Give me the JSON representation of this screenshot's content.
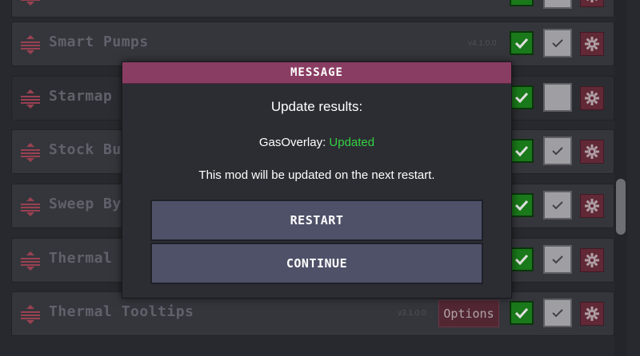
{
  "mods": [
    {
      "name": "",
      "version": "",
      "has_options": false,
      "enabled": true
    },
    {
      "name": "Smart Pumps",
      "version": "v4.1.0.0",
      "has_options": false,
      "enabled": true
    },
    {
      "name": "Starmap Qu",
      "version": "",
      "has_options": false,
      "enabled": true
    },
    {
      "name": "Stock Bug F",
      "version": "",
      "has_options": false,
      "enabled": true
    },
    {
      "name": "Sweep By T",
      "version": "",
      "has_options": false,
      "enabled": true
    },
    {
      "name": "Thermal Int",
      "version": "",
      "has_options": false,
      "enabled": true
    },
    {
      "name": "Thermal Tooltips",
      "version": "v3.1.0.0",
      "has_options": true,
      "options_label": "Options",
      "enabled": true
    }
  ],
  "dialog": {
    "header": "MESSAGE",
    "title": "Update results:",
    "mod_name": "GasOverlay:",
    "mod_status": "Updated",
    "note": "This mod will be updated on the next restart.",
    "restart_label": "RESTART",
    "continue_label": "CONTINUE"
  },
  "colors": {
    "header": "#8a3d62",
    "updated": "#33d141",
    "enabled": "#1e8a1e",
    "button": "#4e5168"
  },
  "icons": {
    "drag_handle": "drag-handle-icon",
    "enable": "checkmark-icon",
    "settings": "gear-icon"
  }
}
